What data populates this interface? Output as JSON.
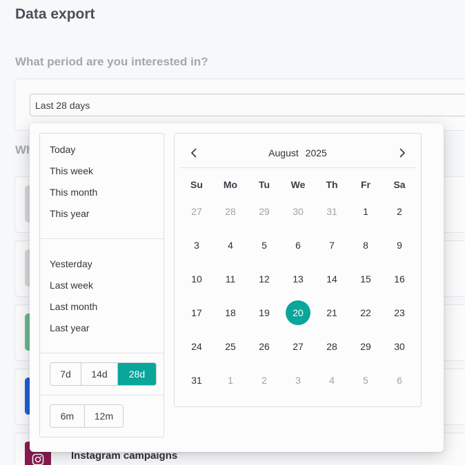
{
  "page": {
    "title": "Data export",
    "period_question": "What period are you interested in?",
    "second_question_partial": "Wh"
  },
  "period_select": {
    "value": "Last 28 days"
  },
  "background_cards": {
    "instagram": {
      "title": "Instagram campaigns"
    }
  },
  "presets": {
    "group1": [
      "Today",
      "This week",
      "This month",
      "This year"
    ],
    "group2": [
      "Yesterday",
      "Last week",
      "Last month",
      "Last year"
    ]
  },
  "quick_ranges": {
    "days": [
      {
        "label": "7d",
        "active": false
      },
      {
        "label": "14d",
        "active": false
      },
      {
        "label": "28d",
        "active": true
      }
    ],
    "months": [
      {
        "label": "6m",
        "active": false
      },
      {
        "label": "12m",
        "active": false
      }
    ]
  },
  "calendar": {
    "month": "August",
    "year": "2025",
    "weekdays": [
      "Su",
      "Mo",
      "Tu",
      "We",
      "Th",
      "Fr",
      "Sa"
    ],
    "weeks": [
      [
        {
          "d": "27",
          "muted": true
        },
        {
          "d": "28",
          "muted": true
        },
        {
          "d": "29",
          "muted": true
        },
        {
          "d": "30",
          "muted": true
        },
        {
          "d": "31",
          "muted": true
        },
        {
          "d": "1"
        },
        {
          "d": "2"
        }
      ],
      [
        {
          "d": "3"
        },
        {
          "d": "4"
        },
        {
          "d": "5"
        },
        {
          "d": "6"
        },
        {
          "d": "7"
        },
        {
          "d": "8"
        },
        {
          "d": "9"
        }
      ],
      [
        {
          "d": "10"
        },
        {
          "d": "11"
        },
        {
          "d": "12"
        },
        {
          "d": "13"
        },
        {
          "d": "14"
        },
        {
          "d": "15"
        },
        {
          "d": "16"
        }
      ],
      [
        {
          "d": "17"
        },
        {
          "d": "18"
        },
        {
          "d": "19"
        },
        {
          "d": "20",
          "selected": true
        },
        {
          "d": "21"
        },
        {
          "d": "22"
        },
        {
          "d": "23"
        }
      ],
      [
        {
          "d": "24"
        },
        {
          "d": "25"
        },
        {
          "d": "26"
        },
        {
          "d": "27"
        },
        {
          "d": "28"
        },
        {
          "d": "29"
        },
        {
          "d": "30"
        }
      ],
      [
        {
          "d": "31"
        },
        {
          "d": "1",
          "muted": true
        },
        {
          "d": "2",
          "muted": true
        },
        {
          "d": "3",
          "muted": true
        },
        {
          "d": "4",
          "muted": true
        },
        {
          "d": "5",
          "muted": true
        },
        {
          "d": "6",
          "muted": true
        }
      ]
    ],
    "icons": {
      "prev": "chevron-left-icon",
      "next": "chevron-right-icon"
    }
  },
  "colors": {
    "accent": "#0aa59b",
    "instagram": "#8a1a4f"
  }
}
